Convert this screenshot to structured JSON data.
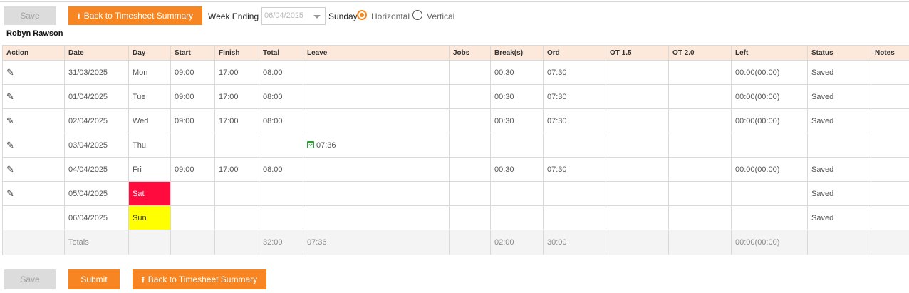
{
  "toolbar": {
    "save_label": "Save",
    "back_label": "Back to Timesheet Summary",
    "week_ending_label": "Week Ending",
    "week_ending_value": "06/04/2025",
    "day_label": "Sunday",
    "layout_options": [
      "Horizontal",
      "Vertical"
    ],
    "layout_selected": "Horizontal"
  },
  "employee_name": "Robyn Rawson",
  "table": {
    "headers": [
      "Action",
      "Date",
      "Day",
      "Start",
      "Finish",
      "Total",
      "Leave",
      "Jobs",
      "Break(s)",
      "Ord",
      "OT 1.5",
      "OT 2.0",
      "Left",
      "Status",
      "Notes"
    ],
    "rows": [
      {
        "date": "31/03/2025",
        "day": "Mon",
        "start": "09:00",
        "finish": "17:00",
        "total": "08:00",
        "leave": "",
        "jobs": "",
        "breaks": "00:30",
        "ord": "07:30",
        "ot15": "",
        "ot20": "",
        "left": "00:00(00:00)",
        "status": "Saved",
        "notes": "",
        "editable": true
      },
      {
        "date": "01/04/2025",
        "day": "Tue",
        "start": "09:00",
        "finish": "17:00",
        "total": "08:00",
        "leave": "",
        "jobs": "",
        "breaks": "00:30",
        "ord": "07:30",
        "ot15": "",
        "ot20": "",
        "left": "00:00(00:00)",
        "status": "Saved",
        "notes": "",
        "editable": true
      },
      {
        "date": "02/04/2025",
        "day": "Wed",
        "start": "09:00",
        "finish": "17:00",
        "total": "08:00",
        "leave": "",
        "jobs": "",
        "breaks": "00:30",
        "ord": "07:30",
        "ot15": "",
        "ot20": "",
        "left": "00:00(00:00)",
        "status": "Saved",
        "notes": "",
        "editable": true
      },
      {
        "date": "03/04/2025",
        "day": "Thu",
        "start": "",
        "finish": "",
        "total": "",
        "leave": "07:36",
        "jobs": "",
        "breaks": "",
        "ord": "",
        "ot15": "",
        "ot20": "",
        "left": "",
        "status": "",
        "notes": "",
        "editable": true
      },
      {
        "date": "04/04/2025",
        "day": "Fri",
        "start": "09:00",
        "finish": "17:00",
        "total": "08:00",
        "leave": "",
        "jobs": "",
        "breaks": "00:30",
        "ord": "07:30",
        "ot15": "",
        "ot20": "",
        "left": "00:00(00:00)",
        "status": "Saved",
        "notes": "",
        "editable": true
      },
      {
        "date": "05/04/2025",
        "day": "Sat",
        "start": "",
        "finish": "",
        "total": "",
        "leave": "",
        "jobs": "",
        "breaks": "",
        "ord": "",
        "ot15": "",
        "ot20": "",
        "left": "",
        "status": "Saved",
        "notes": "",
        "editable": true
      },
      {
        "date": "06/04/2025",
        "day": "Sun",
        "start": "",
        "finish": "",
        "total": "",
        "leave": "",
        "jobs": "",
        "breaks": "",
        "ord": "",
        "ot15": "",
        "ot20": "",
        "left": "",
        "status": "Saved",
        "notes": "",
        "editable": false
      }
    ],
    "totals": {
      "label": "Totals",
      "total": "32:00",
      "leave": "07:36",
      "breaks": "02:00",
      "ord": "30:00",
      "left": "00:00(00:00)"
    }
  },
  "footer": {
    "save_label": "Save",
    "submit_label": "Submit",
    "back_label": "Back to Timesheet Summary"
  },
  "colors": {
    "accent": "#f68522",
    "header_bg": "#fce9dc",
    "saturday": "#ff0b3e",
    "sunday": "#ffff00"
  },
  "icons": {
    "edit": "pencil-icon",
    "leave": "calendar-check-icon",
    "back": "up-arrow-icon"
  }
}
